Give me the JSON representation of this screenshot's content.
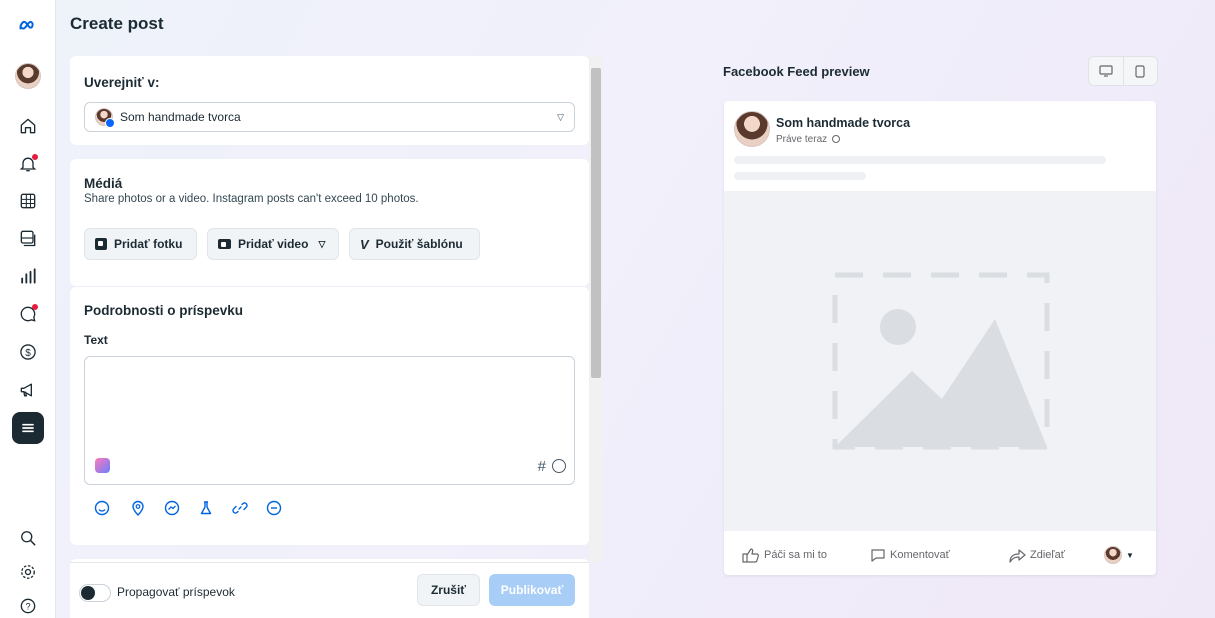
{
  "header": {
    "title": "Create post"
  },
  "nav": {
    "items": [
      "meta-logo-icon",
      "avatar",
      "home-icon",
      "notifications-icon",
      "grid-icon",
      "content-icon",
      "insights-icon",
      "inbox-icon",
      "monetization-icon",
      "ads-icon",
      "menu-icon"
    ],
    "bottom": [
      "search-icon",
      "settings-icon",
      "help-icon"
    ]
  },
  "publish": {
    "title": "Uverejniť v:",
    "selected_account": "Som handmade tvorca"
  },
  "media": {
    "title": "Médiá",
    "subtitle": "Share photos or a video. Instagram posts can't exceed 10 photos.",
    "add_photo": "Pridať fotku",
    "add_video": "Pridať video",
    "use_template": "Použiť šablónu"
  },
  "details": {
    "title": "Podrobnosti o príspevku",
    "text_label": "Text",
    "text_value": "",
    "hashtag_symbol": "#"
  },
  "footer": {
    "boost_label": "Propagovať príspevok",
    "cancel": "Zrušiť",
    "publish": "Publikovať"
  },
  "preview": {
    "title": "Facebook Feed preview",
    "page_name": "Som handmade tvorca",
    "time": "Práve teraz",
    "like": "Páči sa mi to",
    "comment": "Komentovať",
    "share": "Zdieľať"
  },
  "colors": {
    "primary_text": "#1c2b33",
    "publish_disabled": "#a8cdf7",
    "accent_blue": "#0064e0",
    "notification_dot": "#e41e3f"
  }
}
